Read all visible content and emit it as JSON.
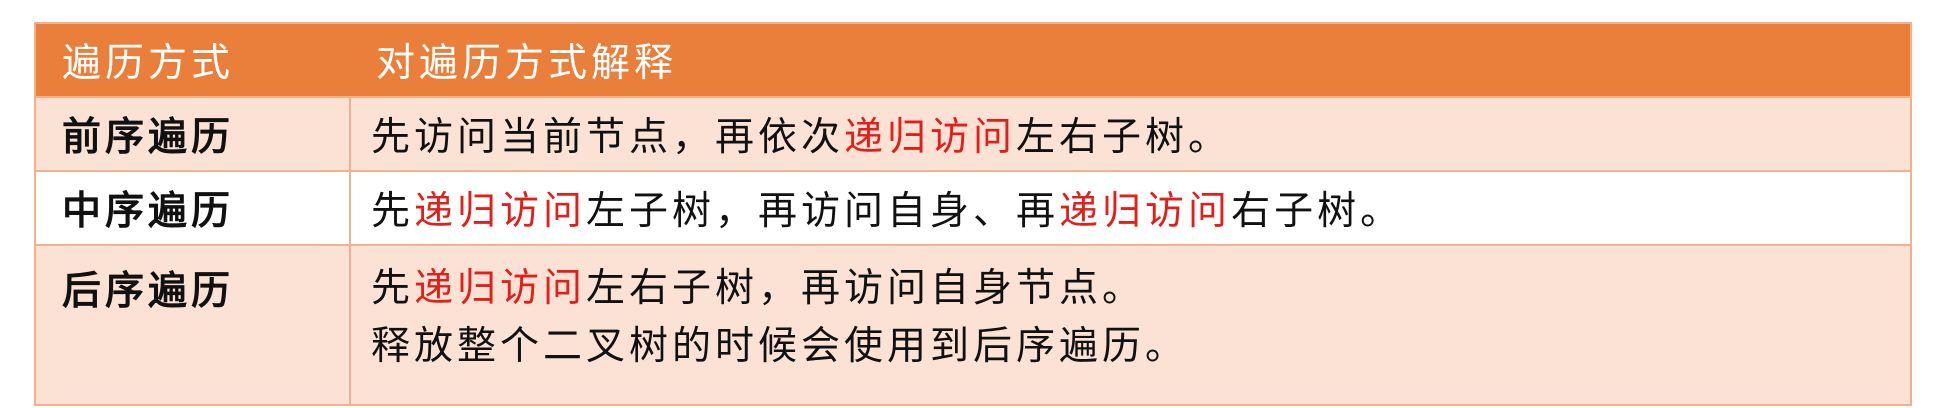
{
  "header": {
    "col1": "遍历方式",
    "col2": "对遍历方式解释"
  },
  "rows": [
    {
      "method": "前序遍历",
      "desc_a": "先访问当前节点，再依次",
      "desc_b": "递归访问",
      "desc_c": "左右子树。"
    },
    {
      "method": "中序遍历",
      "desc_a": "先",
      "desc_b": "递归访问",
      "desc_c": "左子树，再访问自身、再",
      "desc_d": "递归访问",
      "desc_e": "右子树。"
    },
    {
      "method": "后序遍历",
      "desc_a": "先",
      "desc_b": "递归访问",
      "desc_c": "左右子树，再访问自身节点。",
      "desc_line2": "释放整个二叉树的时候会使用到后序遍历。"
    }
  ],
  "colors": {
    "header_bg": "#EA7F3B",
    "row_odd_bg": "#FBE2D5",
    "border": "#F3B08A",
    "highlight": "#E0201B"
  }
}
